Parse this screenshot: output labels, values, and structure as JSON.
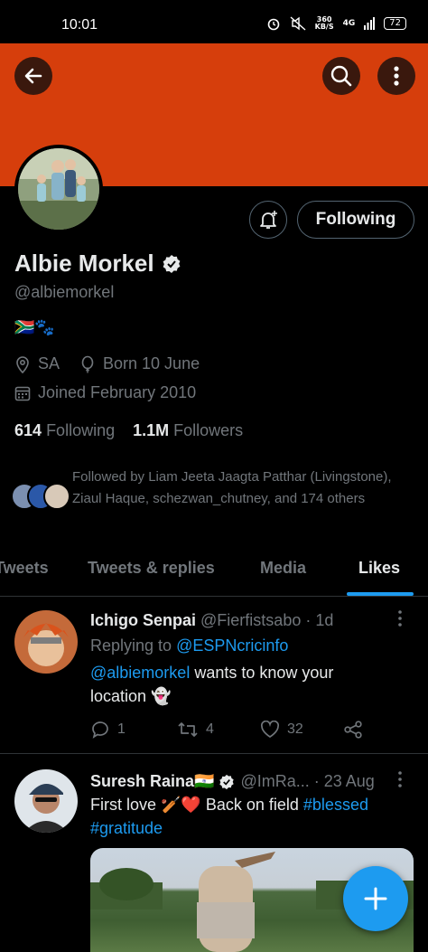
{
  "status_bar": {
    "time": "10:01",
    "speed": "360",
    "speed_unit": "KB/S",
    "network": "4G",
    "battery": "72"
  },
  "header": {
    "banner_color": "#d63e0c",
    "back_icon": "arrow-left-icon",
    "search_icon": "search-icon",
    "more_icon": "more-vertical-icon"
  },
  "profile": {
    "name": "Albie Morkel",
    "handle": "@albiemorkel",
    "bio": "🇿🇦🐾",
    "location": "SA",
    "birthday": "Born 10 June",
    "joined": "Joined February 2010",
    "following_count": "614",
    "following_label": "Following",
    "followers_count": "1.1M",
    "followers_label": "Followers",
    "following_button": "Following",
    "followed_by": "Followed by Liam Jeeta Jaagta Patthar (Livingstone), Ziaul Haque, schezwan_chutney, and 174 others"
  },
  "tabs": [
    {
      "label": "Tweets"
    },
    {
      "label": "Tweets & replies"
    },
    {
      "label": "Media"
    },
    {
      "label": "Likes",
      "active": true
    }
  ],
  "tweets": [
    {
      "author": "Ichigo Senpai",
      "handle": "@Fierfistsabo",
      "sep": "·",
      "time": "1d",
      "replying_label": "Replying to",
      "replying_to": "@ESPNcricinfo",
      "mention": "@albiemorkel",
      "text_line1": " wants to know your",
      "text_line2": "location 👻",
      "replies": "1",
      "retweets": "4",
      "likes": "32"
    },
    {
      "author": "Suresh Raina🇮🇳",
      "handle": "@ImRa...",
      "sep": "·",
      "time": "23 Aug",
      "text_line1": "First love 🏏❤️ Back on field ",
      "hashtag1": "#blessed",
      "hashtag2": "#gratitude"
    }
  ],
  "fab": {
    "icon": "plus-icon",
    "color": "#1d9bf0"
  }
}
